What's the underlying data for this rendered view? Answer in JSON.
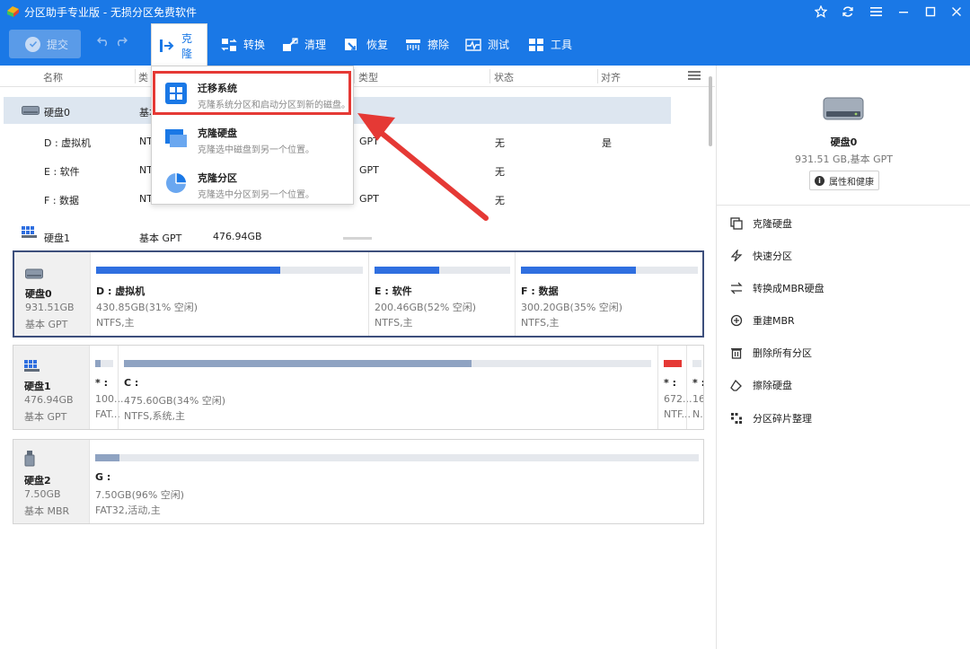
{
  "window": {
    "title": "分区助手专业版 - 无损分区免费软件",
    "controls": [
      "star-icon",
      "refresh-icon",
      "menu-icon",
      "minimize-icon",
      "maximize-icon",
      "close-icon"
    ]
  },
  "toolbar": {
    "submit_label": "提交",
    "tools": [
      {
        "label": "克隆",
        "icon": "clone-icon",
        "active": true
      },
      {
        "label": "转换",
        "icon": "convert-icon"
      },
      {
        "label": "清理",
        "icon": "clean-icon"
      },
      {
        "label": "恢复",
        "icon": "recover-icon"
      },
      {
        "label": "擦除",
        "icon": "wipe-icon"
      },
      {
        "label": "测试",
        "icon": "test-icon"
      },
      {
        "label": "工具",
        "icon": "tools-icon"
      }
    ]
  },
  "table": {
    "headers": {
      "name": "名称",
      "type": "类",
      "type2": "类型",
      "status": "状态",
      "align": "对齐"
    },
    "rows": [
      {
        "name": "硬盘0",
        "fs": "基本",
        "ptype": "",
        "status": "",
        "align": ""
      },
      {
        "name": "D : 虚拟机",
        "fs": "NT",
        "ptype": "GPT",
        "status": "无",
        "align": "是"
      },
      {
        "name": "E : 软件",
        "fs": "NT",
        "ptype": "GPT",
        "status": "无",
        "align": ""
      },
      {
        "name": "F : 数据",
        "fs": "NT",
        "ptype": "GPT",
        "status": "无",
        "align": ""
      },
      {
        "name": "硬盘1",
        "fs": "基本 GPT",
        "size": "476.94GB"
      }
    ]
  },
  "dropdown": {
    "items": [
      {
        "title": "迁移系统",
        "desc": "克隆系统分区和启动分区到新的磁盘。"
      },
      {
        "title": "克隆硬盘",
        "desc": "克隆选中磁盘到另一个位置。"
      },
      {
        "title": "克隆分区",
        "desc": "克隆选中分区到另一个位置。"
      }
    ]
  },
  "disks": [
    {
      "name": "硬盘0",
      "size": "931.51GB",
      "type": "基本 GPT",
      "partitions": [
        {
          "name": "D : 虚拟机",
          "info": "430.85GB(31% 空闲)",
          "fs": "NTFS,主",
          "used": 0.69,
          "color": "#2f6fe0"
        },
        {
          "name": "E : 软件",
          "info": "200.46GB(52% 空闲)",
          "fs": "NTFS,主",
          "used": 0.48,
          "color": "#2f6fe0"
        },
        {
          "name": "F : 数据",
          "info": "300.20GB(35% 空闲)",
          "fs": "NTFS,主",
          "used": 0.65,
          "color": "#2f6fe0"
        }
      ]
    },
    {
      "name": "硬盘1",
      "size": "476.94GB",
      "type": "基本 GPT",
      "partitions": [
        {
          "name": "* :",
          "info": "100...",
          "fs": "FAT...",
          "used": 0.3,
          "color": "#8fa3c2"
        },
        {
          "name": "C :",
          "info": "475.60GB(34% 空闲)",
          "fs": "NTFS,系统,主",
          "used": 0.66,
          "color": "#8fa3c2"
        },
        {
          "name": "* :",
          "info": "672...",
          "fs": "NTF...",
          "used": 1.0,
          "color": "#e53935"
        },
        {
          "name": "* :",
          "info": "16...",
          "fs": "N...",
          "used": 0.0,
          "color": "#8fa3c2"
        }
      ]
    },
    {
      "name": "硬盘2",
      "size": "7.50GB",
      "type": "基本 MBR",
      "partitions": [
        {
          "name": "G :",
          "info": "7.50GB(96% 空闲)",
          "fs": "FAT32,活动,主",
          "used": 0.04,
          "color": "#8fa3c2"
        }
      ]
    }
  ],
  "right_panel": {
    "disk_name": "硬盘0",
    "disk_sub": "931.51 GB,基本 GPT",
    "props_label": "属性和健康",
    "actions": [
      {
        "label": "克隆硬盘",
        "icon": "clone-disk-icon"
      },
      {
        "label": "快速分区",
        "icon": "lightning-icon"
      },
      {
        "label": "转换成MBR硬盘",
        "icon": "convert-icon"
      },
      {
        "label": "重建MBR",
        "icon": "rebuild-icon"
      },
      {
        "label": "删除所有分区",
        "icon": "trash-icon"
      },
      {
        "label": "擦除硬盘",
        "icon": "eraser-icon"
      },
      {
        "label": "分区碎片整理",
        "icon": "defrag-icon"
      }
    ]
  },
  "colors": {
    "brand": "#1a78e6",
    "bar_blue": "#2f6fe0",
    "bar_gray": "#8fa3c2",
    "bar_red": "#e53935",
    "highlight": "#e53935"
  }
}
